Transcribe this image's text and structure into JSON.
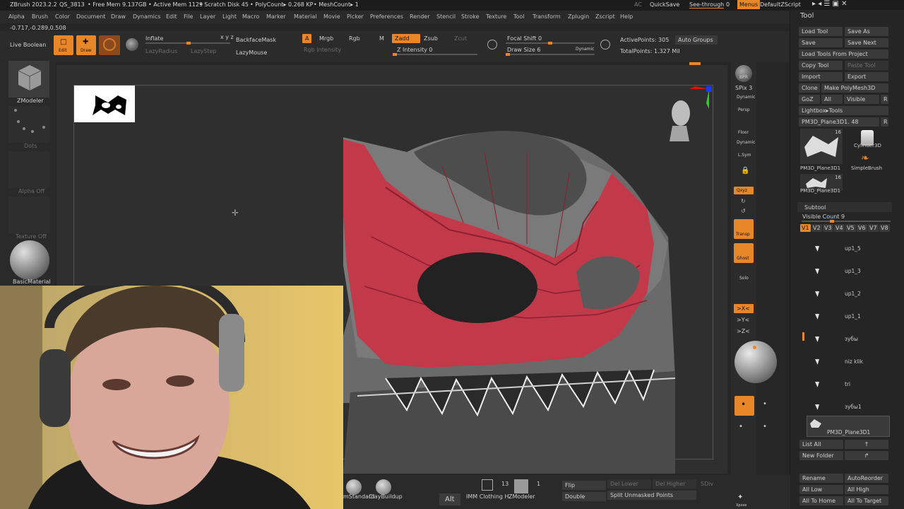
{
  "titlebar": {
    "app": "ZBrush 2023.2.2",
    "qs": "QS_3813",
    "free_mem": "• Free Mem 9.137GB",
    "active_mem": "• Active Mem 1129",
    "scratch": "• Scratch Disk 45",
    "polycount": "• PolyCount▸ 0.268 KP",
    "meshcount": "• MeshCount▸ 1",
    "ac": "AC",
    "quicksave": "QuickSave",
    "seethrough": "See-through",
    "seethrough_val": "0",
    "menus": "Menus",
    "script": "DefaultZScript"
  },
  "menubar": [
    "Alpha",
    "Brush",
    "Color",
    "Document",
    "Draw",
    "Dynamics",
    "Edit",
    "File",
    "Layer",
    "Light",
    "Macro",
    "Marker",
    "Material",
    "Movie",
    "Picker",
    "Preferences",
    "Render",
    "Stencil",
    "Stroke",
    "Texture",
    "Tool",
    "Transform",
    "Zplugin",
    "Zscript",
    "Help"
  ],
  "coords": "-0.717,-0.289,0.508",
  "shelf": {
    "live_boolean": "Live Boolean",
    "edit": "Edit",
    "draw": "Draw",
    "inflate": "Inflate",
    "lazyradius": "LazyRadius",
    "lazystep": "LazyStep",
    "backfacemask": "BackfaceMask",
    "lazymouse": "LazyMouse",
    "a": "A",
    "mrgb": "Mrgb",
    "rgb": "Rgb",
    "m": "M",
    "zadd": "Zadd",
    "zsub": "Zsub",
    "zcut": "Zcut",
    "rgb_intensity": "Rgb Intensity",
    "z_intensity": "Z Intensity 0",
    "focal_shift": "Focal Shift 0",
    "draw_size": "Draw Size 6",
    "dynamic": "Dynamic",
    "active_points": "ActivePoints: 305",
    "total_points": "TotalPoints: 1.327 Mil",
    "auto_groups": "Auto Groups"
  },
  "left": {
    "zmodeler": "ZModeler",
    "dots": "Dots",
    "alpha_off": "Alpha Off",
    "texture_off": "Texture Off",
    "material": "BasicMaterial"
  },
  "right_shelf": {
    "bpr": "BPR",
    "spix": "SPix 3",
    "dynamic": "Dynamic",
    "persp": "Persp",
    "floor": "Floor",
    "lsym": "L.Sym",
    "qxyz": "Qxyz",
    "transp": "Transp",
    "ghost": "Ghost",
    "solo": "Solo",
    "x": ">X<",
    "y": ">Y<",
    "z": ">Z<"
  },
  "tool_panel": {
    "title": "Tool",
    "load_tool": "Load Tool",
    "save_as": "Save As",
    "save": "Save",
    "save_next": "Save Next",
    "load_from_project": "Load Tools From Project",
    "copy_tool": "Copy Tool",
    "paste_tool": "Paste Tool",
    "import": "Import",
    "export": "Export",
    "clone": "Clone",
    "make_polymesh": "Make PolyMesh3D",
    "goz": "GoZ",
    "all": "All",
    "visible": "Visible",
    "r": "R",
    "lightbox_tools": "Lightbox▸Tools",
    "current_tool": "PM3D_Plane3D1. 48",
    "thumb1_count": "16",
    "thumb1_label": "PM3D_Plane3D1",
    "cylinder": "Cylinder3D",
    "simplebrush": "SimpleBrush",
    "thumb2_count": "16",
    "thumb2_label": "PM3D_Plane3D1",
    "subtool": "Subtool",
    "visible_count": "Visible Count 9",
    "versions": [
      "V1",
      "V2",
      "V3",
      "V4",
      "V5",
      "V6",
      "V7",
      "V8"
    ],
    "subtools": [
      "up1_5",
      "up1_3",
      "up1_2",
      "up1_1",
      "зубы",
      "niz klik",
      "tri",
      "зубы1"
    ],
    "selected_subtool": "PM3D_Plane3D1",
    "list_all": "List All",
    "new_folder": "New Folder",
    "rename": "Rename",
    "auto_reorder": "AutoReorder",
    "all_low": "All Low",
    "all_high": "All High",
    "all_to_home": "All To Home",
    "all_to_target": "All To Target"
  },
  "bottom": {
    "brush1": "mStandard",
    "brush2": "ClayBuildup",
    "alt": "Alt",
    "imm": "IMM Clothing H.",
    "count": "13",
    "zmodeler": "ZModeler",
    "zmodeler_count": "1",
    "flip": "Flip",
    "double": "Double",
    "del_lower": "Del Lower",
    "del_higher": "Del Higher",
    "sdiv": "SDiv",
    "split_unmasked": "Split Unmasked Points",
    "xpose": "Xpose"
  },
  "colors": {
    "accent": "#e8872a",
    "mask_red": "#c23a4a",
    "panel": "#252525"
  }
}
